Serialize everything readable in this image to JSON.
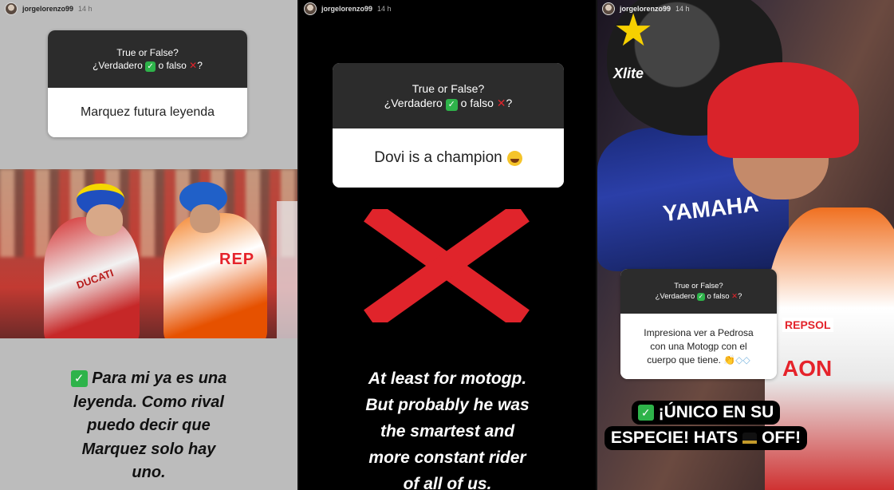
{
  "panels": [
    {
      "username": "jorgelorenzo99",
      "time": "14 h",
      "question": {
        "header_line1": "True or False?",
        "header_line2_pre": "¿Verdadero",
        "header_line2_mid": "o falso",
        "header_line2_post": "?",
        "answer": "Marquez futura leyenda"
      },
      "photo_labels": {
        "repsol": "REP",
        "ducati": "DUCATI"
      },
      "caption_lines": [
        "Para mi ya es una",
        "leyenda. Como rival",
        "puedo decir que",
        "Marquez solo hay",
        "uno."
      ]
    },
    {
      "username": "jorgelorenzo99",
      "time": "14 h",
      "question": {
        "header_line1": "True or False?",
        "header_line2_pre": "¿Verdadero",
        "header_line2_mid": "o falso",
        "header_line2_post": "?",
        "answer": "Dovi is a champion"
      },
      "caption_lines": [
        "At least for motogp.",
        "But probably he was",
        "the smartest and",
        "more constant rider",
        "of all of us."
      ]
    },
    {
      "username": "jorgelorenzo99",
      "time": "14 h",
      "question": {
        "header_line1": "True or False?",
        "header_line2_pre": "¿Verdadero",
        "header_line2_mid": "o falso",
        "header_line2_post": "?",
        "answer_line1": "Impresiona ver a Pedrosa",
        "answer_line2": "con una Motogp con el",
        "answer_line3": "cuerpo que tiene."
      },
      "photo_labels": {
        "xlite": "Xlite",
        "yamaha": "YAMAHA",
        "repsol": "REPSOL",
        "aon": "AON"
      },
      "caption_line1": "¡ÚNICO EN SU",
      "caption_line2_pre": "ESPECIE! HATS",
      "caption_line2_post": "OFF!"
    }
  ],
  "icons": {
    "check": "✓",
    "cross": "✕"
  },
  "colors": {
    "check_green": "#2eb34a",
    "cross_red": "#e0242b",
    "question_header": "#2c2c2c"
  }
}
